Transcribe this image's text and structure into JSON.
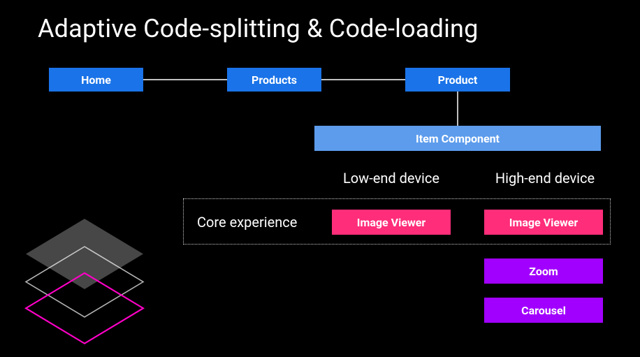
{
  "title": "Adaptive Code-splitting & Code-loading",
  "nav": {
    "home": "Home",
    "products": "Products",
    "product": "Product"
  },
  "item_component": "Item Component",
  "columns": {
    "low": "Low-end device",
    "high": "High-end device"
  },
  "core_label": "Core experience",
  "modules": {
    "low": {
      "image_viewer": "Image Viewer"
    },
    "high": {
      "image_viewer": "Image Viewer",
      "zoom": "Zoom",
      "carousel": "Carousel"
    }
  },
  "colors": {
    "blue": "#1a73e8",
    "lightblue": "#5d9cec",
    "pink": "#ff2d7a",
    "purple": "#a100ff",
    "accent_magenta": "#ff00c8"
  }
}
